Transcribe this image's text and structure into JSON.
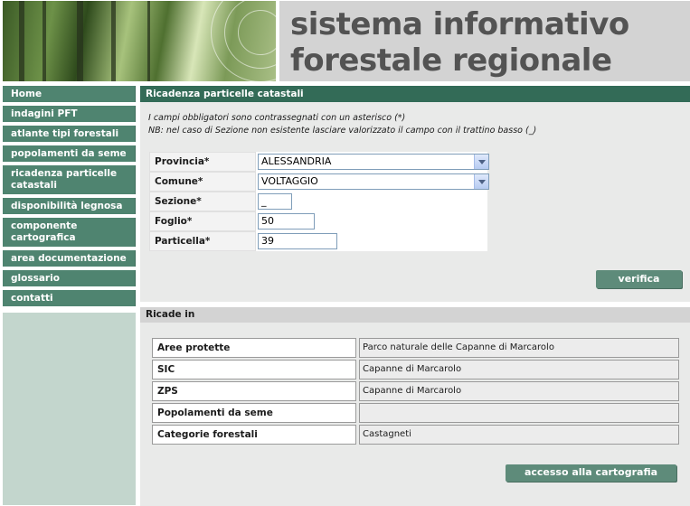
{
  "header": {
    "title_line1": "sistema informativo",
    "title_line2": "forestale regionale"
  },
  "sidebar": {
    "items": [
      {
        "label": "Home"
      },
      {
        "label": "indagini PFT"
      },
      {
        "label": "atlante tipi forestali"
      },
      {
        "label": "popolamenti da seme"
      },
      {
        "label": "ricadenza particelle catastali"
      },
      {
        "label": "disponibilità legnosa"
      },
      {
        "label": "componente cartografica"
      },
      {
        "label": "area documentazione"
      },
      {
        "label": "glossario"
      },
      {
        "label": "contatti"
      }
    ]
  },
  "form": {
    "title": "Ricadenza particelle catastali",
    "note1": "I campi obbligatori sono contrassegnati con un asterisco (*)",
    "note2": "NB: nel caso di Sezione non esistente lasciare valorizzato il campo con il trattino basso (_)",
    "provincia_label": "Provincia*",
    "provincia_value": "ALESSANDRIA",
    "comune_label": "Comune*",
    "comune_value": "VOLTAGGIO",
    "sezione_label": "Sezione*",
    "sezione_value": "_",
    "foglio_label": "Foglio*",
    "foglio_value": "50",
    "particella_label": "Particella*",
    "particella_value": "39",
    "verify_button": "verifica"
  },
  "results": {
    "title": "Ricade in",
    "rows": [
      {
        "label": "Aree protette",
        "value": "Parco naturale delle Capanne di Marcarolo"
      },
      {
        "label": "SIC",
        "value": "Capanne di Marcarolo"
      },
      {
        "label": "ZPS",
        "value": "Capanne di Marcarolo"
      },
      {
        "label": "Popolamenti da seme",
        "value": ""
      },
      {
        "label": "Categorie forestali",
        "value": "Castagneti"
      }
    ],
    "map_button": "accesso alla cartografia"
  }
}
